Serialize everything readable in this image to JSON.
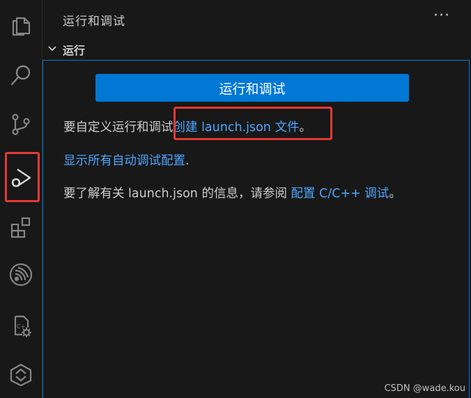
{
  "activity_bar": {
    "items": [
      {
        "name": "explorer-icon"
      },
      {
        "name": "search-icon"
      },
      {
        "name": "source-control-icon"
      },
      {
        "name": "run-debug-icon",
        "active": true
      },
      {
        "name": "extensions-icon"
      },
      {
        "name": "espressif-idf-icon"
      },
      {
        "name": "cmake-tools-icon"
      },
      {
        "name": "remote-explorer-icon"
      }
    ]
  },
  "sidebar": {
    "title": "运行和调试",
    "more_actions": "···",
    "section": {
      "title": "运行",
      "run_button_label": "运行和调试",
      "line1_prefix": "要自定义运行和调试",
      "line1_link": "创建 launch.json 文件",
      "line1_suffix": "。",
      "line2_link": "显示所有自动调试配置",
      "line2_suffix": ".",
      "line3_prefix": "要了解有关 launch.json 的信息，请参阅 ",
      "line3_link": "配置 C/C++ 调试",
      "line3_suffix": "。"
    }
  },
  "colors": {
    "background": "#181818",
    "accent": "#0078d4",
    "link": "#4da6ff",
    "annotation": "#e53935"
  },
  "watermark": "CSDN @wade.kou"
}
